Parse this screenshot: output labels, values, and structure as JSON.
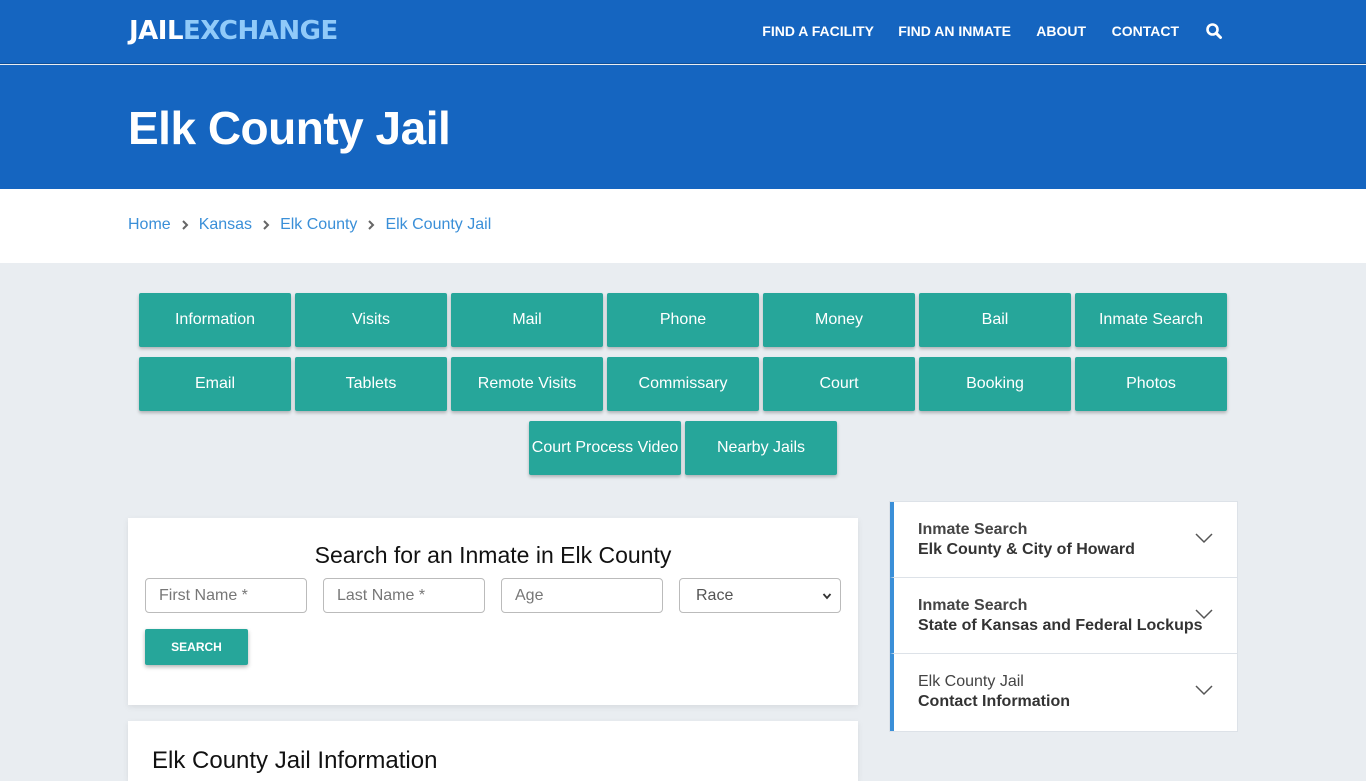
{
  "header": {
    "logo_part1": "JAIL",
    "logo_part2": "EXCHANGE",
    "nav": [
      {
        "label": "FIND A FACILITY"
      },
      {
        "label": "FIND AN INMATE"
      },
      {
        "label": "ABOUT"
      },
      {
        "label": "CONTACT"
      }
    ],
    "search_icon": "search-icon"
  },
  "hero": {
    "title": "Elk County Jail"
  },
  "breadcrumb": [
    {
      "label": "Home"
    },
    {
      "label": "Kansas"
    },
    {
      "label": "Elk County"
    },
    {
      "label": "Elk County Jail"
    }
  ],
  "topic_buttons": [
    {
      "label": "Information"
    },
    {
      "label": "Visits"
    },
    {
      "label": "Mail"
    },
    {
      "label": "Phone"
    },
    {
      "label": "Money"
    },
    {
      "label": "Bail"
    },
    {
      "label": "Inmate Search"
    },
    {
      "label": "Email"
    },
    {
      "label": "Tablets"
    },
    {
      "label": "Remote Visits"
    },
    {
      "label": "Commissary"
    },
    {
      "label": "Court"
    },
    {
      "label": "Booking"
    },
    {
      "label": "Photos"
    },
    {
      "label": "Court Process Video"
    },
    {
      "label": "Nearby Jails"
    }
  ],
  "search_form": {
    "title": "Search for an Inmate in Elk County",
    "first_name_placeholder": "First Name *",
    "last_name_placeholder": "Last Name *",
    "age_placeholder": "Age",
    "race_selected": "Race",
    "submit_label": "SEARCH"
  },
  "info_section": {
    "title": "Elk County Jail Information"
  },
  "sidebar_accordion": [
    {
      "line1": "Inmate Search",
      "line2": "Elk County & City of Howard"
    },
    {
      "line1": "Inmate Search",
      "line2": "State of Kansas and Federal Lockups"
    },
    {
      "line1": "Elk County Jail",
      "line2": "Contact Information"
    }
  ],
  "colors": {
    "brand_blue": "#1565c0",
    "logo_accent": "#90caf9",
    "teal_button": "#26a69a",
    "link_blue": "#3a8fd8",
    "page_bg": "#e9edf1"
  }
}
